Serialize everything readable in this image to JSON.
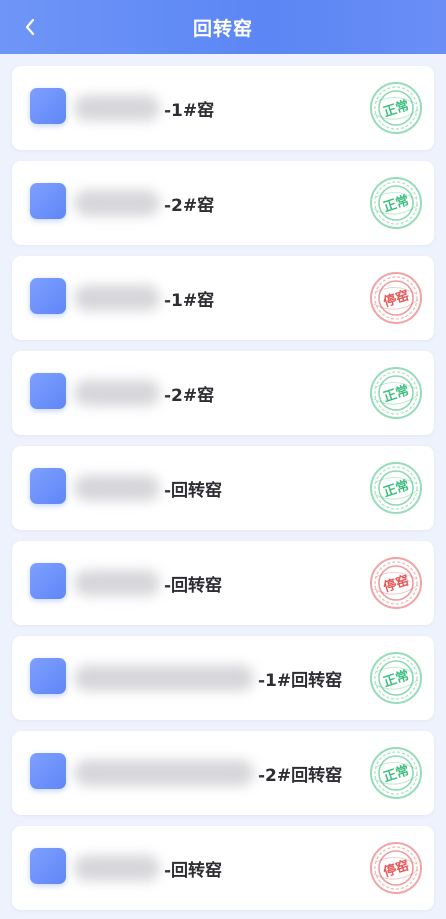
{
  "header": {
    "title": "回转窑",
    "back_icon": "chevron-left-icon"
  },
  "colors": {
    "header_blue": "#5b86f4",
    "normal_green": "#3fbf7f",
    "stopped_red": "#e35a5a",
    "icon_blue": "#6b8ff7"
  },
  "kilns": [
    {
      "label": "-1#窑",
      "status": "正常",
      "status_type": "normal",
      "blur": "short"
    },
    {
      "label": "-2#窑",
      "status": "正常",
      "status_type": "normal",
      "blur": "short"
    },
    {
      "label": "-1#窑",
      "status": "停窑",
      "status_type": "stopped",
      "blur": "short"
    },
    {
      "label": "-2#窑",
      "status": "正常",
      "status_type": "normal",
      "blur": "short"
    },
    {
      "label": "-回转窑",
      "status": "正常",
      "status_type": "normal",
      "blur": "short"
    },
    {
      "label": "-回转窑",
      "status": "停窑",
      "status_type": "stopped",
      "blur": "short"
    },
    {
      "label": "-1#回转窑",
      "status": "正常",
      "status_type": "normal",
      "blur": "long"
    },
    {
      "label": "-2#回转窑",
      "status": "正常",
      "status_type": "normal",
      "blur": "long"
    },
    {
      "label": "-回转窑",
      "status": "停窑",
      "status_type": "stopped",
      "blur": "short"
    }
  ]
}
